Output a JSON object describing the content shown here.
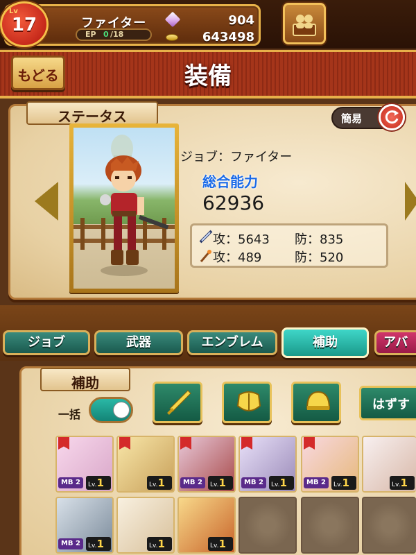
{
  "player": {
    "level_label": "Lv",
    "level": "17",
    "name": "ファイター",
    "ep_label": "EP",
    "ep_current": "0",
    "ep_max": "/18",
    "crystals": "904",
    "gold": "643498"
  },
  "header": {
    "back_label": "もどる",
    "title": "装備"
  },
  "status": {
    "tab_label": "ステータス",
    "simple_label": "簡易",
    "job_line": "ジョブ：ファイター",
    "power_title": "総合能力",
    "power_value": "62936",
    "phys_atk": "攻：5643",
    "phys_def": "防：835",
    "mag_atk": "攻：489",
    "mag_def": "防：520"
  },
  "tabs": [
    {
      "label": "ジョブ"
    },
    {
      "label": "武器"
    },
    {
      "label": "エンブレム"
    },
    {
      "label": "補助"
    },
    {
      "label": "アバ"
    }
  ],
  "support": {
    "tab_label": "補助",
    "bulk_label": "一括",
    "remove_label": "はずす"
  },
  "cards": [
    {
      "mb": "MB 2",
      "lv_label": "Lv.",
      "lv": "1"
    },
    {
      "mb": "",
      "lv_label": "Lv.",
      "lv": "1"
    },
    {
      "mb": "MB 2",
      "lv_label": "Lv.",
      "lv": "1"
    },
    {
      "mb": "MB 2",
      "lv_label": "Lv.",
      "lv": "1"
    },
    {
      "mb": "MB 2",
      "lv_label": "Lv.",
      "lv": "1"
    },
    {
      "mb": "",
      "lv_label": "Lv.",
      "lv": "1"
    },
    {
      "mb": "MB 2",
      "lv_label": "Lv.",
      "lv": "1"
    },
    {
      "mb": "",
      "lv_label": "Lv.",
      "lv": "1"
    },
    {
      "mb": "",
      "lv_label": "Lv.",
      "lv": "1"
    }
  ],
  "colors": {
    "accent_teal": "#1a9a8a",
    "gold_border": "#e8c25a",
    "power_blue": "#1a6ae8"
  }
}
